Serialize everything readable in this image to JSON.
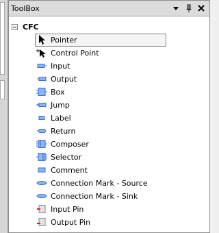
{
  "panel": {
    "title": "ToolBox"
  },
  "tree": {
    "group_label": "CFC",
    "expanded": true,
    "items": [
      {
        "label": "Pointer",
        "icon": "pointer-icon",
        "selected": true
      },
      {
        "label": "Control Point",
        "icon": "control-point-icon"
      },
      {
        "label": "Input",
        "icon": "input-icon"
      },
      {
        "label": "Output",
        "icon": "output-icon"
      },
      {
        "label": "Box",
        "icon": "box-icon"
      },
      {
        "label": "Jump",
        "icon": "jump-icon"
      },
      {
        "label": "Label",
        "icon": "label-icon"
      },
      {
        "label": "Return",
        "icon": "return-icon"
      },
      {
        "label": "Composer",
        "icon": "composer-icon"
      },
      {
        "label": "Selector",
        "icon": "selector-icon"
      },
      {
        "label": "Comment",
        "icon": "comment-icon"
      },
      {
        "label": "Connection Mark - Source",
        "icon": "connection-mark-source-icon"
      },
      {
        "label": "Connection Mark - Sink",
        "icon": "connection-mark-sink-icon"
      },
      {
        "label": "Input Pin",
        "icon": "input-pin-icon"
      },
      {
        "label": "Output Pin",
        "icon": "output-pin-icon"
      }
    ]
  },
  "colors": {
    "icon_blue": "#3a6fd8",
    "icon_blue_fill": "#8fb4f2",
    "pin_red": "#c0282d"
  }
}
